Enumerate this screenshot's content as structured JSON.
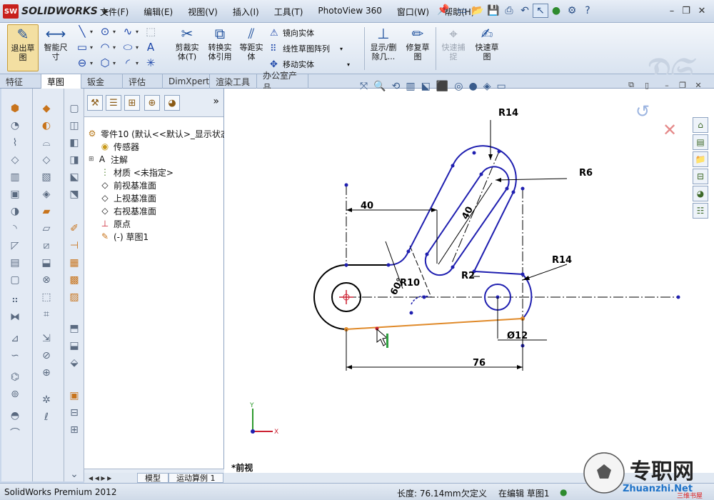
{
  "app": {
    "brand_badge": "SW",
    "brand_name": "SOLIDWORKS"
  },
  "menu": [
    "文件(F)",
    "编辑(E)",
    "视图(V)",
    "插入(I)",
    "工具(T)",
    "PhotoView 360",
    "窗口(W)",
    "帮助(H)"
  ],
  "ribbon": {
    "exit_sketch": "退出草\n图",
    "smart_dim": "智能尺\n寸",
    "trim": "剪裁实\n体(T)",
    "convert": "转换实\n体引用",
    "offset": "等距实\n体",
    "mirror": "镜向实体",
    "linear_pattern": "线性草图阵列",
    "move": "移动实体",
    "show_delete": "显示/删\n除几...",
    "repair": "修复草\n图",
    "quick_snap": "快速捕\n捉",
    "rapid_sketch": "快速草\n图"
  },
  "tabs": [
    "特征",
    "草图",
    "钣金",
    "评估",
    "DimXpert",
    "渲染工具",
    "办公室产品"
  ],
  "tree": {
    "root": "零件10  (默认<<默认>_显示状态",
    "items": [
      "传感器",
      "注解",
      "材质 <未指定>",
      "前视基准面",
      "上视基准面",
      "右视基准面",
      "原点",
      "(-) 草图1"
    ]
  },
  "drawing": {
    "dims": {
      "r14_top": "R14",
      "r6": "R6",
      "d40_horizontal": "40",
      "d40_slot": "40",
      "r14_right": "R14",
      "r10": "R10",
      "r2": "R2",
      "angle60": "60°",
      "dia12": "Ø12",
      "d76": "76"
    },
    "colors": {
      "fully_defined": "#000000",
      "under_defined": "#1f1fb0",
      "selected": "#e08a2a",
      "centerline": "#000000",
      "endpoint": "#1f1fb0"
    }
  },
  "axis": {
    "y": "Y",
    "x": "X"
  },
  "view_label": "*前视",
  "bottom_tabs": [
    "模型",
    "运动算例 1"
  ],
  "status": {
    "product": "SolidWorks Premium 2012",
    "length": "长度: 76.14mm",
    "state": "欠定义",
    "editing": "在编辑 草图1"
  },
  "watermark": {
    "cn": "专职网",
    "en": "Zhuanzhi.Net",
    "sub": "三维书屋"
  }
}
